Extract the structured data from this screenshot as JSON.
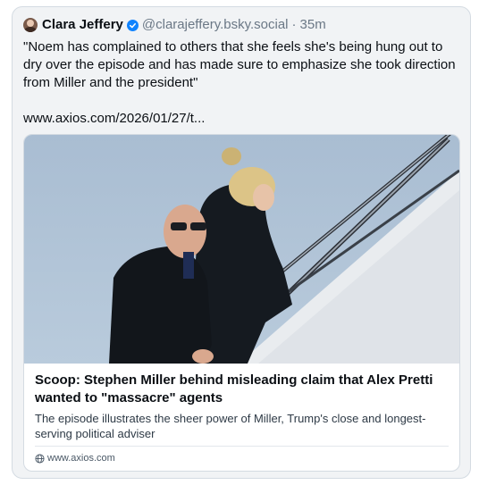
{
  "post": {
    "author": {
      "display_name": "Clara Jeffery",
      "handle": "@clarajeffery.bsky.social",
      "separator": "·",
      "time": "35m",
      "verified": true
    },
    "text": "\"Noem has complained to others that she feels she's being hung out to dry over the episode and has made sure to emphasize she took direction from Miller and the president\"",
    "link_text": "www.axios.com/2026/01/27/t...",
    "link_card": {
      "title": "Scoop: Stephen Miller behind misleading claim that Alex Pretti wanted to \"massacre\" agents",
      "description": "The episode illustrates the sheer power of Miller, Trump's close and longest-serving political adviser",
      "domain": "www.axios.com",
      "domain_icon": "globe-icon"
    }
  },
  "colors": {
    "background": "#f1f3f5",
    "verified_badge": "#1083fe",
    "secondary_text": "#6b7886",
    "border": "#d4dbe2"
  }
}
